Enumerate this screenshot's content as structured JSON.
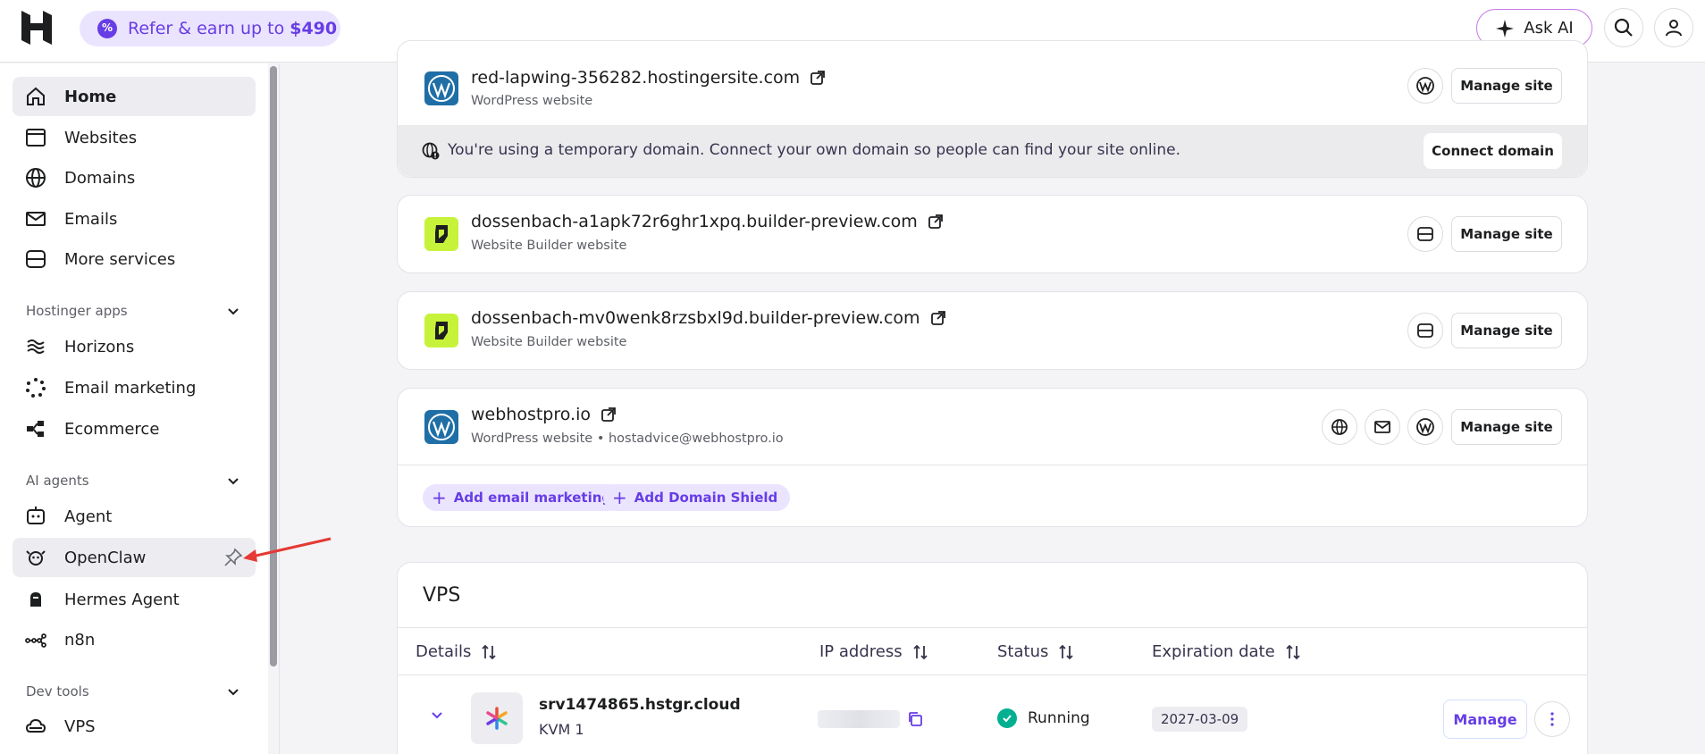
{
  "topbar": {
    "refer_text": "Refer & earn up to",
    "refer_amount": "$490",
    "ask_ai": "Ask AI"
  },
  "sidebar": {
    "items": [
      {
        "label": "Home",
        "icon": "home-icon"
      },
      {
        "label": "Websites",
        "icon": "browser-icon"
      },
      {
        "label": "Domains",
        "icon": "globe-icon"
      },
      {
        "label": "Emails",
        "icon": "mail-icon"
      },
      {
        "label": "More services",
        "icon": "server-icon"
      }
    ],
    "section_apps": "Hostinger apps",
    "apps": [
      {
        "label": "Horizons",
        "icon": "horizons-icon"
      },
      {
        "label": "Email marketing",
        "icon": "email-marketing-icon"
      },
      {
        "label": "Ecommerce",
        "icon": "ecommerce-icon"
      }
    ],
    "section_agents": "AI agents",
    "agents": [
      {
        "label": "Agent",
        "icon": "agent-icon"
      },
      {
        "label": "OpenClaw",
        "icon": "openclaw-icon"
      },
      {
        "label": "Hermes Agent",
        "icon": "hermes-icon"
      },
      {
        "label": "n8n",
        "icon": "n8n-icon"
      }
    ],
    "section_dev": "Dev tools",
    "dev": [
      {
        "label": "VPS",
        "icon": "vps-icon"
      }
    ]
  },
  "sites": [
    {
      "name": "red-lapwing-356282.hostingersite.com",
      "type": "WordPress website"
    },
    {
      "name": "dossenbach-a1apk72r6ghr1xpq.builder-preview.com",
      "type": "Website Builder website"
    },
    {
      "name": "dossenbach-mv0wenk8rzsbxl9d.builder-preview.com",
      "type": "Website Builder website"
    },
    {
      "name": "webhostpro.io",
      "type": "WordPress website • hostadvice@webhostpro.io"
    }
  ],
  "notice": {
    "text": "You're using a temporary domain. Connect your own domain so people can find your site online.",
    "button": "Connect domain"
  },
  "manage_site_label": "Manage site",
  "pills": {
    "email_marketing": "Add email marketing",
    "domain_shield": "Add Domain Shield"
  },
  "vps": {
    "title": "VPS",
    "columns": [
      "Details",
      "IP address",
      "Status",
      "Expiration date"
    ],
    "row": {
      "hostname": "srv1474865.hstgr.cloud",
      "plan": "KVM 1",
      "status": "Running",
      "expiration": "2027-03-09",
      "manage": "Manage"
    }
  },
  "colors": {
    "accent": "#673de6",
    "running": "#00b090",
    "annotation_arrow": "#e53935"
  }
}
